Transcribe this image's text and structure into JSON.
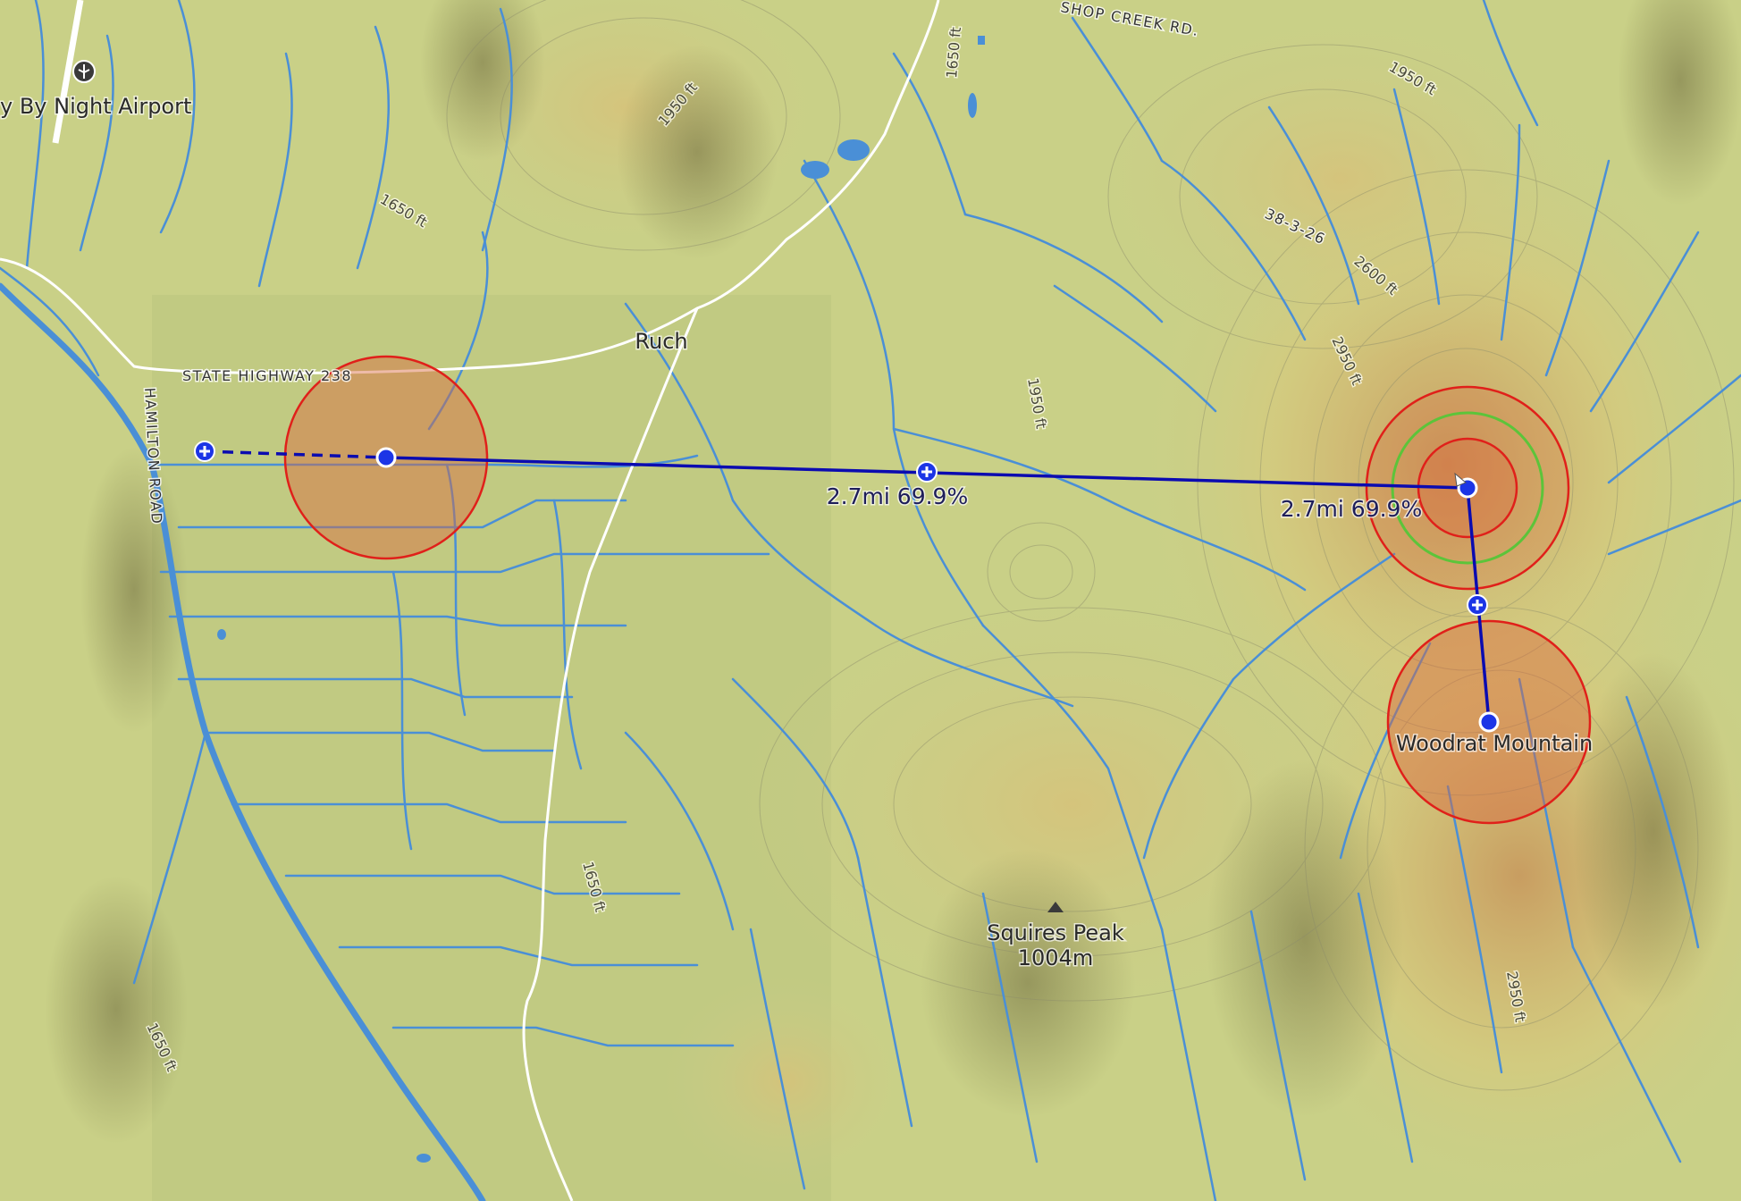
{
  "map": {
    "places": {
      "airport": "y By Night Airport",
      "town": "Ruch",
      "peak_name": "Squires Peak",
      "peak_elev": "1004m",
      "mountain": "Woodrat Mountain"
    },
    "roads": {
      "highway": "STATE HIGHWAY 238",
      "hamilton": "HAMILTON ROAD",
      "creek_rd": "SHOP CREEK RD.",
      "forest_rd": "38-3-26"
    },
    "contours": {
      "c1": "1650 ft",
      "c2": "1950 ft",
      "c3": "1650 ft",
      "c4": "1950 ft",
      "c5": "2600 ft",
      "c6": "2950 ft",
      "c7": "1950 ft",
      "c8": "1650 ft",
      "c9": "2950 ft",
      "c10": "1650 ft"
    },
    "route": {
      "leg1_label": "2.7mi 69.9%",
      "leg2_label": "2.7mi 69.9%"
    },
    "colors": {
      "terrain": "#c9cf8a",
      "water": "#4a8fd6",
      "route": "#0b0bb0",
      "zone_stroke": "#e0201a",
      "zone_fill": "#d9693d",
      "goal_ring": "#5cc43a"
    },
    "icons": {
      "airport": "airport-icon",
      "peak": "peak-triangle-icon",
      "waypoint": "waypoint-dot-icon",
      "add_point": "add-point-icon"
    }
  }
}
